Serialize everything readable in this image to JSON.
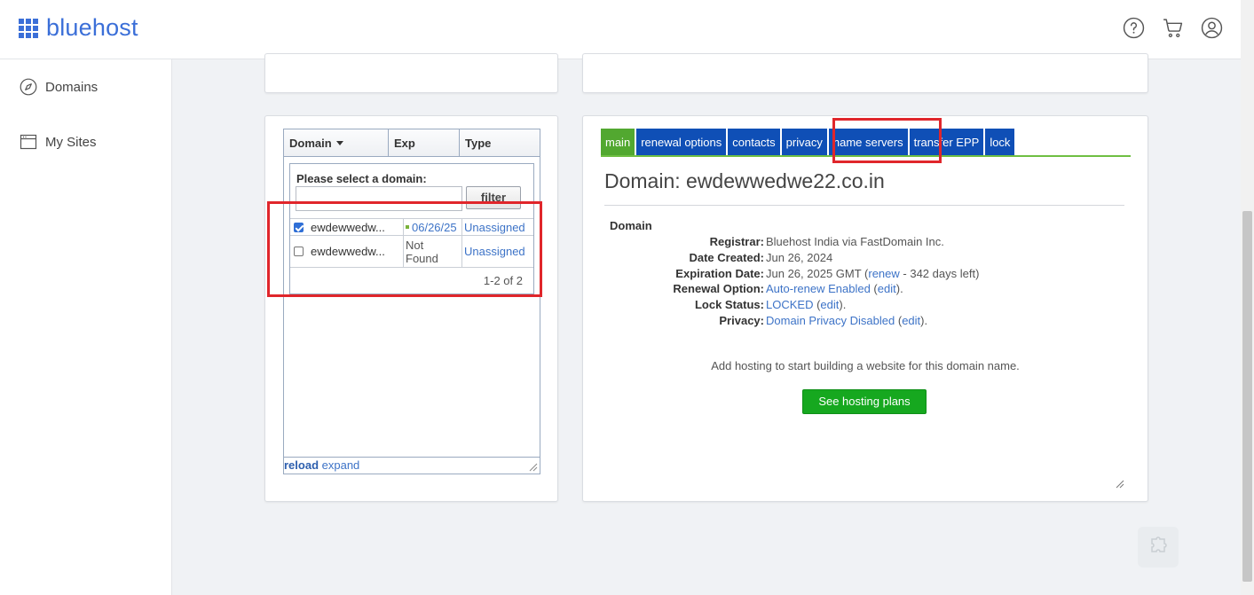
{
  "header": {
    "logo_text": "bluehost",
    "icons": [
      "help-icon",
      "cart-icon",
      "account-icon"
    ]
  },
  "sidebar": {
    "items": [
      {
        "label": "Domains",
        "icon": "compass-icon"
      },
      {
        "label": "My Sites",
        "icon": "browser-window-icon"
      }
    ]
  },
  "domain_list": {
    "columns": [
      "Domain",
      "Exp",
      "Type"
    ],
    "prompt": "Please select a domain:",
    "filter_value": "",
    "filter_label": "filter",
    "rows": [
      {
        "checked": true,
        "domain": "ewdewwedw...",
        "exp": "06/26/25",
        "type": "Unassigned"
      },
      {
        "checked": false,
        "domain": "ewdewwedw...",
        "exp": "Not Found",
        "type": "Unassigned"
      }
    ],
    "count": "1-2 of 2",
    "reload_label": "reload",
    "expand_label": "expand"
  },
  "detail": {
    "tabs": [
      {
        "label": "main",
        "active": true
      },
      {
        "label": "renewal options",
        "active": false
      },
      {
        "label": "contacts",
        "active": false
      },
      {
        "label": "privacy",
        "active": false
      },
      {
        "label": "name servers",
        "active": false
      },
      {
        "label": "transfer EPP",
        "active": false
      },
      {
        "label": "lock",
        "active": false
      }
    ],
    "title": "Domain: ewdewwedwe22.co.in",
    "section": "Domain",
    "registrar": {
      "label": "Registrar",
      "value": "Bluehost India via FastDomain Inc."
    },
    "date_created": {
      "label": "Date Created",
      "value": "Jun 26, 2024"
    },
    "expiration": {
      "label": "Expiration Date",
      "value": "Jun 26, 2025 GMT (",
      "renew": "renew",
      "days": " - 342 days left)"
    },
    "renewal_option": {
      "label": "Renewal Option",
      "value": "Auto-renew Enabled",
      "edit": "edit",
      "close": ")."
    },
    "lock_status": {
      "label": "Lock Status",
      "value": "LOCKED",
      "edit": "edit",
      "close": ")."
    },
    "privacy": {
      "label": "Privacy",
      "value": "Domain Privacy Disabled",
      "edit": "edit",
      "close": ")."
    },
    "hosting_message": "Add hosting to start building a website for this domain name.",
    "hosting_button": "See hosting plans"
  },
  "colors": {
    "brand": "#3b6fd8",
    "tab_blue": "#0f4fb6",
    "tab_active": "#52a830",
    "highlight": "#e0262b",
    "cta_green": "#16a81f"
  }
}
